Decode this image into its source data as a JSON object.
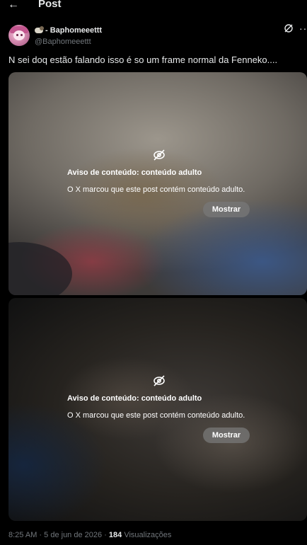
{
  "header": {
    "back_icon": "arrow-left-icon",
    "title": "Post"
  },
  "author": {
    "emoji_icon": "sheep-emoji-icon",
    "name": "- Baphomeeettt",
    "handle": "@Baphomeeettt"
  },
  "actions": {
    "grok_icon": "grok-icon",
    "more_label": "···"
  },
  "tweet": {
    "text": "N sei doq estão falando isso é so um frame normal da Fenneko...."
  },
  "media": [
    {
      "warning_icon": "eye-slash-icon",
      "warning_title": "Aviso de conteúdo: conteúdo adulto",
      "warning_text": "O X marcou que este post contém conteúdo adulto.",
      "button_label": "Mostrar"
    },
    {
      "warning_icon": "eye-slash-icon",
      "warning_title": "Aviso de conteúdo: conteúdo adulto",
      "warning_text": "O X marcou que este post contém conteúdo adulto.",
      "button_label": "Mostrar"
    }
  ],
  "meta": {
    "time": "8:25 AM",
    "separator": "·",
    "date": "5 de jun de 2026",
    "views_count": "184",
    "views_label": "Visualizações"
  },
  "colors": {
    "background": "#000000",
    "text": "#e7e9ea",
    "secondary": "#71767b",
    "button": "#787878"
  }
}
